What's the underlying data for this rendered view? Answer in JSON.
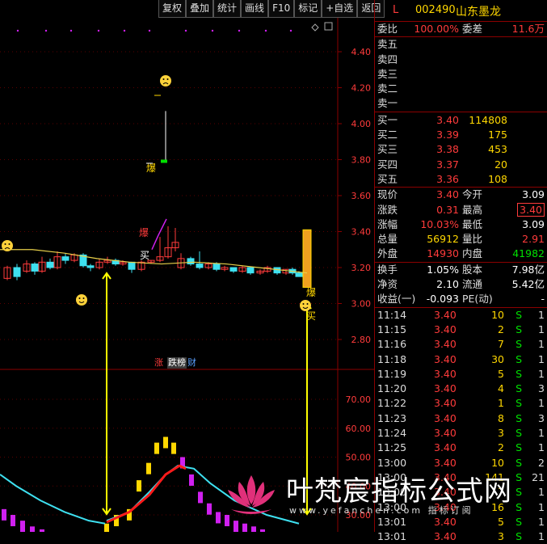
{
  "toolbar": {
    "items": [
      "复权",
      "叠加",
      "统计",
      "画线",
      "F10",
      "标记",
      "+自选",
      "返回"
    ]
  },
  "chart": {
    "price_axis": [
      "4.40",
      "4.20",
      "4.00",
      "3.80",
      "3.60",
      "3.40",
      "3.20",
      "3.00",
      "2.80"
    ],
    "indicator_axis": [
      "70.00",
      "60.00",
      "50.00",
      "40.00",
      "30.00"
    ],
    "baozha_label": "爆",
    "mai_label": "买",
    "indicator_tags": {
      "zhang": "涨",
      "jie": "跌榜",
      "cai": "财"
    }
  },
  "stock": {
    "market": "L",
    "code": "002490",
    "name": "山东墨龙"
  },
  "order_book": {
    "weibi_label": "委比",
    "weibi": "100.00%",
    "weicha_label": "委差",
    "weicha": "11.6万",
    "asks": [
      {
        "label": "卖五"
      },
      {
        "label": "卖四"
      },
      {
        "label": "卖三"
      },
      {
        "label": "卖二"
      },
      {
        "label": "卖一"
      }
    ],
    "bids": [
      {
        "label": "买一",
        "price": "3.40",
        "vol": "114808"
      },
      {
        "label": "买二",
        "price": "3.39",
        "vol": "175"
      },
      {
        "label": "买三",
        "price": "3.38",
        "vol": "453"
      },
      {
        "label": "买四",
        "price": "3.37",
        "vol": "20"
      },
      {
        "label": "买五",
        "price": "3.36",
        "vol": "108"
      }
    ]
  },
  "quote": [
    {
      "l1": "现价",
      "v1": "3.40",
      "l2": "今开",
      "v2": "3.09",
      "c1": "red",
      "c2": "wht"
    },
    {
      "l1": "涨跌",
      "v1": "0.31",
      "l2": "最高",
      "v2": "3.40",
      "c1": "red",
      "c2": "red box"
    },
    {
      "l1": "涨幅",
      "v1": "10.03%",
      "l2": "最低",
      "v2": "3.09",
      "c1": "red",
      "c2": "wht"
    },
    {
      "l1": "总量",
      "v1": "56912",
      "l2": "量比",
      "v2": "2.91",
      "c1": "yel",
      "c2": "red"
    },
    {
      "l1": "外盘",
      "v1": "14930",
      "l2": "内盘",
      "v2": "41982",
      "c1": "red",
      "c2": "green"
    }
  ],
  "fundamentals": [
    {
      "l1": "换手",
      "v1": "1.05%",
      "l2": "股本",
      "v2": "7.98亿"
    },
    {
      "l1": "净资",
      "v1": "2.10",
      "l2": "流通",
      "v2": "5.42亿"
    },
    {
      "l1": "收益(一)",
      "v1": "-0.093",
      "l2": "PE(动)",
      "v2": "-"
    }
  ],
  "ticks": [
    {
      "t": "11:14",
      "p": "3.40",
      "q": "10",
      "s": "S",
      "n": "1"
    },
    {
      "t": "11:15",
      "p": "3.40",
      "q": "2",
      "s": "S",
      "n": "1"
    },
    {
      "t": "11:16",
      "p": "3.40",
      "q": "7",
      "s": "S",
      "n": "1"
    },
    {
      "t": "11:18",
      "p": "3.40",
      "q": "30",
      "s": "S",
      "n": "1"
    },
    {
      "t": "11:19",
      "p": "3.40",
      "q": "5",
      "s": "S",
      "n": "1"
    },
    {
      "t": "11:20",
      "p": "3.40",
      "q": "4",
      "s": "S",
      "n": "3"
    },
    {
      "t": "11:22",
      "p": "3.40",
      "q": "1",
      "s": "S",
      "n": "1"
    },
    {
      "t": "11:23",
      "p": "3.40",
      "q": "8",
      "s": "S",
      "n": "3"
    },
    {
      "t": "11:24",
      "p": "3.40",
      "q": "3",
      "s": "S",
      "n": "1"
    },
    {
      "t": "11:25",
      "p": "3.40",
      "q": "2",
      "s": "S",
      "n": "1"
    },
    {
      "t": "13:00",
      "p": "3.40",
      "q": "10",
      "s": "S",
      "n": "2"
    },
    {
      "t": "13:00",
      "p": "3.40",
      "q": "141",
      "s": "S",
      "n": "21"
    },
    {
      "t": "13:00",
      "p": "3.40",
      "q": "7",
      "s": "S",
      "n": "1"
    },
    {
      "t": "13:00",
      "p": "3.40",
      "q": "16",
      "s": "S",
      "n": "1"
    },
    {
      "t": "13:01",
      "p": "3.40",
      "q": "5",
      "s": "S",
      "n": "1"
    },
    {
      "t": "13:01",
      "p": "3.40",
      "q": "3",
      "s": "S",
      "n": "1"
    }
  ],
  "watermark": {
    "title": "叶梵宸指标公式网",
    "url": "www.yefanchen.com 指标订阅"
  },
  "colors": {
    "up": "#ff3b3b",
    "down": "#00e000",
    "price": "#ff3b3b",
    "accent": "#ffd700",
    "ma": "#e8d04a",
    "cyan": "#3ee0f0",
    "magenta": "#d020f0"
  }
}
